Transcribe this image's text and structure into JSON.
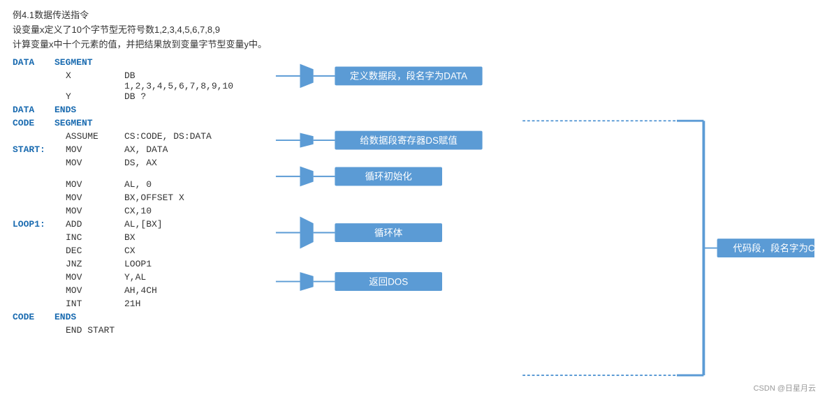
{
  "description": {
    "line1": "例4.1数据传送指令",
    "line2": "设变量x定义了10个字节型无符号数1,2,3,4,5,6,7,8,9",
    "line3": "计算变量x中十个元素的值，并把结果放到变量字节型变量y中。"
  },
  "code": [
    {
      "label": "DATA",
      "keyword": "SEGMENT",
      "operand": "",
      "labelBlue": true,
      "keywordBlue": true
    },
    {
      "label": "",
      "keyword": "X",
      "indent_kw": true,
      "operand": "DB 1,2,3,4,5,6,7,8,9,10",
      "labelBlue": false,
      "keywordBlue": false
    },
    {
      "label": "",
      "keyword": "Y",
      "indent_kw": true,
      "operand": "DB ?",
      "labelBlue": false,
      "keywordBlue": false
    },
    {
      "label": "DATA",
      "keyword": "ENDS",
      "operand": "",
      "labelBlue": true,
      "keywordBlue": true
    },
    {
      "label": "CODE",
      "keyword": "SEGMENT",
      "operand": "",
      "labelBlue": true,
      "keywordBlue": true
    },
    {
      "label": "",
      "keyword": "ASSUME",
      "indent_kw": false,
      "operand": "CS:CODE, DS:DATA",
      "labelBlue": false,
      "keywordBlue": false
    },
    {
      "label": "START:",
      "keyword": "MOV",
      "operand": "AX, DATA",
      "labelBlue": false,
      "keywordBlue": false
    },
    {
      "label": "",
      "keyword": "MOV",
      "operand": "DS, AX",
      "labelBlue": false,
      "keywordBlue": false
    },
    {
      "label": "",
      "keyword": "",
      "operand": "",
      "labelBlue": false,
      "keywordBlue": false
    },
    {
      "label": "",
      "keyword": "MOV",
      "operand": "AL, 0",
      "labelBlue": false,
      "keywordBlue": false
    },
    {
      "label": "",
      "keyword": "MOV",
      "operand": "BX,OFFSET X",
      "labelBlue": false,
      "keywordBlue": false
    },
    {
      "label": "",
      "keyword": "MOV",
      "operand": "CX,10",
      "labelBlue": false,
      "keywordBlue": false
    },
    {
      "label": "LOOP1:",
      "keyword": "ADD",
      "operand": "AL,[BX]",
      "labelBlue": false,
      "keywordBlue": false
    },
    {
      "label": "",
      "keyword": "INC",
      "operand": "BX",
      "labelBlue": false,
      "keywordBlue": false
    },
    {
      "label": "",
      "keyword": "DEC",
      "operand": "CX",
      "labelBlue": false,
      "keywordBlue": false
    },
    {
      "label": "",
      "keyword": "JNZ",
      "operand": "LOOP1",
      "labelBlue": false,
      "keywordBlue": false
    },
    {
      "label": "",
      "keyword": "MOV",
      "operand": "Y,AL",
      "labelBlue": false,
      "keywordBlue": false
    },
    {
      "label": "",
      "keyword": "MOV",
      "operand": "AH,4CH",
      "labelBlue": false,
      "keywordBlue": false
    },
    {
      "label": "",
      "keyword": "INT",
      "operand": "21H",
      "labelBlue": false,
      "keywordBlue": false
    },
    {
      "label": "CODE",
      "keyword": "ENDS",
      "operand": "",
      "labelBlue": true,
      "keywordBlue": true
    },
    {
      "label": "",
      "keyword": "END START",
      "operand": "",
      "labelBlue": false,
      "keywordBlue": false
    }
  ],
  "boxes": {
    "data_segment": "定义数据段，段名字为DATA",
    "ds_assign": "给数据段寄存器DS赋值",
    "loop_init": "循环初始化",
    "loop_body": "循环体",
    "return_dos": "返回DOS",
    "code_segment": "代码段，段名字为CODE"
  },
  "watermark": "CSDN @日星月云"
}
